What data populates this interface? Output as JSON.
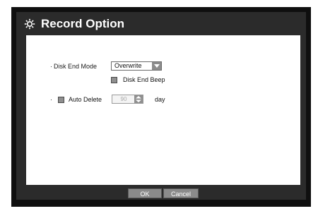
{
  "dialog": {
    "title": "Record Option",
    "title_icon": "gear-icon"
  },
  "disk_end_mode": {
    "label": "Disk End Mode",
    "selected": "Overwrite"
  },
  "disk_end_beep": {
    "label": "Disk End Beep",
    "checked": false
  },
  "auto_delete": {
    "label": "Auto Delete",
    "checked": false,
    "value": "90",
    "unit": "day"
  },
  "buttons": {
    "ok_label": "OK",
    "cancel_label": "Cancel"
  },
  "colors": {
    "window_bg": "#2b2b2b",
    "outer_bg": "#0f0f0f",
    "content_bg": "#ffffff",
    "button_bg": "#8b8b8b"
  }
}
